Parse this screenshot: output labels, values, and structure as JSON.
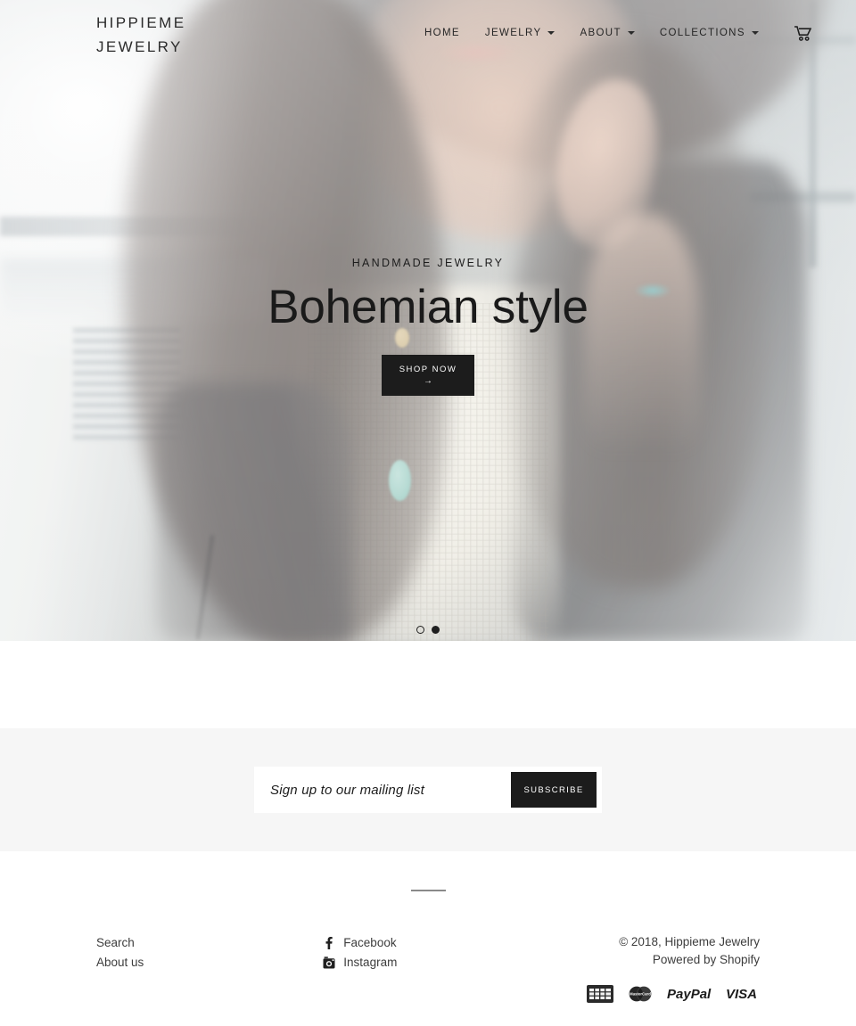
{
  "header": {
    "brand": "HIPPIEME\nJEWELRY",
    "nav": [
      {
        "label": "HOME",
        "has_caret": false
      },
      {
        "label": "JEWELRY",
        "has_caret": true
      },
      {
        "label": "ABOUT",
        "has_caret": true
      },
      {
        "label": "COLLECTIONS",
        "has_caret": true
      }
    ],
    "cart_icon": "shopping-cart-icon"
  },
  "hero": {
    "kicker": "HANDMADE JEWELRY",
    "title": "Bohemian style",
    "button_label": "SHOP NOW",
    "button_arrow": "→",
    "slides": [
      {
        "index": 1,
        "active": false
      },
      {
        "index": 2,
        "active": true
      }
    ]
  },
  "newsletter": {
    "placeholder": "Sign up to our mailing list",
    "value": "",
    "button_label": "SUBSCRIBE"
  },
  "footer": {
    "links": [
      {
        "label": "Search"
      },
      {
        "label": "About us"
      }
    ],
    "social": [
      {
        "label": "Facebook",
        "icon": "facebook-icon"
      },
      {
        "label": "Instagram",
        "icon": "instagram-icon"
      }
    ],
    "copyright": "© 2018, Hippieme Jewelry",
    "powered_by": "Powered by Shopify",
    "payment_methods": [
      {
        "name": "american-express",
        "label": "AMERICAN EXPRESS"
      },
      {
        "name": "mastercard",
        "label": "MasterCard"
      },
      {
        "name": "paypal",
        "label": "PayPal"
      },
      {
        "name": "visa",
        "label": "VISA"
      }
    ]
  },
  "colors": {
    "dark": "#1c1c1c",
    "text": "#3d3d3d",
    "newsletter_bg": "#f6f6f6",
    "divider": "#8a8a8a"
  }
}
